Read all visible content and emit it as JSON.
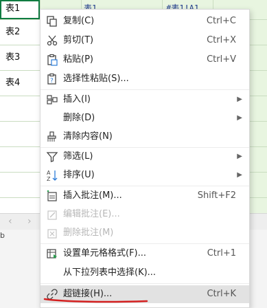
{
  "sheet": {
    "cells": [
      "表1",
      "表2",
      "表3",
      "表4"
    ],
    "col_b_value": "表1",
    "col_c_value": "#表1!A1",
    "status_char": "b"
  },
  "nav": {
    "prev": "‹",
    "next": "›"
  },
  "menu": {
    "items": [
      {
        "label": "复制(C)",
        "shortcut": "Ctrl+C",
        "icon": "copy-icon"
      },
      {
        "label": "剪切(T)",
        "shortcut": "Ctrl+X",
        "icon": "scissors-icon"
      },
      {
        "label": "粘贴(P)",
        "shortcut": "Ctrl+V",
        "icon": "paste-icon"
      },
      {
        "label": "选择性粘贴(S)...",
        "shortcut": "",
        "icon": "paste-special-icon"
      },
      {
        "label": "插入(I)",
        "shortcut": "",
        "icon": "insert-icon"
      },
      {
        "label": "删除(D)",
        "shortcut": "",
        "icon": ""
      },
      {
        "label": "清除内容(N)",
        "shortcut": "",
        "icon": "eraser-icon"
      },
      {
        "label": "筛选(L)",
        "shortcut": "",
        "icon": "filter-icon"
      },
      {
        "label": "排序(U)",
        "shortcut": "",
        "icon": "sort-icon"
      },
      {
        "label": "插入批注(M)...",
        "shortcut": "Shift+F2",
        "icon": "comment-add-icon"
      },
      {
        "label": "编辑批注(E)...",
        "shortcut": "",
        "icon": "comment-edit-icon"
      },
      {
        "label": "删除批注(M)",
        "shortcut": "",
        "icon": "comment-delete-icon"
      },
      {
        "label": "设置单元格格式(F)...",
        "shortcut": "Ctrl+1",
        "icon": "format-cells-icon"
      },
      {
        "label": "从下拉列表中选择(K)...",
        "shortcut": "",
        "icon": ""
      },
      {
        "label": "超链接(H)...",
        "shortcut": "Ctrl+K",
        "icon": "link-icon"
      }
    ]
  },
  "colors": {
    "accent": "#107c41",
    "highlight": "#e2e2e2",
    "annotation": "#d42020"
  }
}
